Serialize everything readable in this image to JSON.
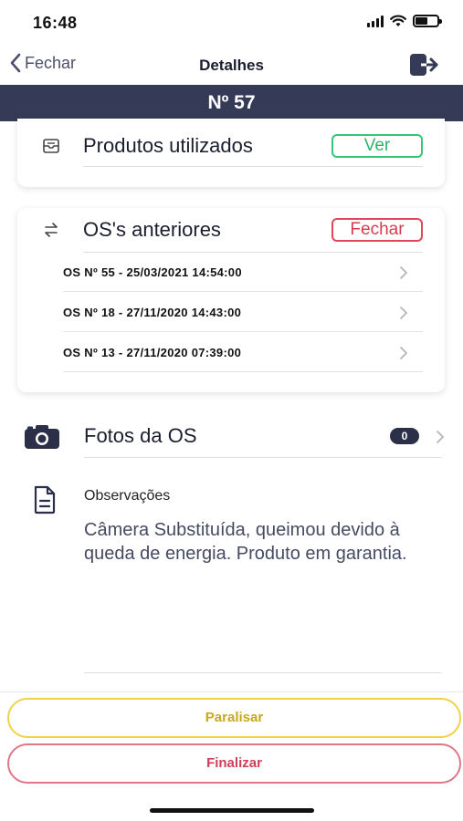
{
  "status_bar": {
    "time": "16:48"
  },
  "nav": {
    "back_label": "Fechar",
    "title": "Detalhes"
  },
  "banner": {
    "number": "Nº 57"
  },
  "produtos": {
    "title": "Produtos utilizados",
    "action_label": "Ver"
  },
  "anteriores": {
    "title": "OS's anteriores",
    "action_label": "Fechar",
    "items": [
      {
        "label": "OS Nº 55 - 25/03/2021 14:54:00"
      },
      {
        "label": "OS Nº 18 - 27/11/2020 14:43:00"
      },
      {
        "label": "OS Nº 13 - 27/11/2020 07:39:00"
      }
    ]
  },
  "fotos": {
    "label": "Fotos da OS",
    "count": "0"
  },
  "observacoes": {
    "label": "Observações",
    "text": "Câmera Substituída, queimou devido à queda de energia. Produto em garantia."
  },
  "actions": {
    "paralisar_label": "Paralisar",
    "finalizar_label": "Finalizar"
  },
  "colors": {
    "banner": "#353a56",
    "ver_green": "#35c776",
    "fechar_red": "#e0485a",
    "paralisar_yellow": "#efd24a",
    "finalizar_red": "#cf3e59"
  },
  "icons": {
    "back": "chevron-left-icon",
    "logout": "logout-icon",
    "produtos": "box-icon",
    "anteriores": "swap-arrows-icon",
    "fotos": "camera-icon",
    "observacoes": "document-icon"
  }
}
